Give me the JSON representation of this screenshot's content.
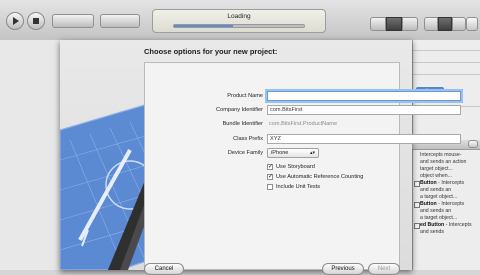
{
  "toolbar": {
    "status_text": "Loading",
    "progress": 0.45,
    "run_icon": "play-icon",
    "stop_icon": "stop-icon"
  },
  "inspector": {
    "button_label": "tion",
    "library_items": [
      {
        "title": "",
        "desc": "Intercepts mouse-"
      },
      {
        "title": "",
        "desc": "and sends an action"
      },
      {
        "title": "",
        "desc": "target object..."
      },
      {
        "title": "",
        "desc": "object when..."
      },
      {
        "title": "Button",
        "desc": " - Intercepts"
      },
      {
        "title": "",
        "desc": "and sends an"
      },
      {
        "title": "",
        "desc": "a target object..."
      },
      {
        "title": "Button",
        "desc": " - Intercepts"
      },
      {
        "title": "",
        "desc": "and sends an"
      },
      {
        "title": "",
        "desc": "a target object..."
      },
      {
        "title": "ed Button",
        "desc": " - Intercepts"
      },
      {
        "title": "",
        "desc": "and sends"
      }
    ]
  },
  "sheet": {
    "title": "Choose options for your new project:",
    "fields": {
      "product_name": {
        "label": "Product Name",
        "value": ""
      },
      "company_identifier": {
        "label": "Company Identifier",
        "value": "com.BitsFirst"
      },
      "bundle_identifier": {
        "label": "Bundle Identifier",
        "value": "com.BitsFirst.ProductName"
      },
      "class_prefix": {
        "label": "Class Prefix",
        "value": "XYZ"
      },
      "device_family": {
        "label": "Device Family",
        "value": "iPhone"
      }
    },
    "options": [
      {
        "label": "Use Storyboard",
        "checked": true,
        "mark": "✓"
      },
      {
        "label": "Use Automatic Reference Counting",
        "checked": true,
        "mark": "✓"
      },
      {
        "label": "Include Unit Tests",
        "checked": false,
        "mark": ""
      }
    ],
    "buttons": {
      "cancel": "Cancel",
      "previous": "Previous",
      "next": "Next"
    }
  },
  "colors": {
    "accent": "#5a85c2",
    "focus_ring": "#9cc0ee",
    "blueprint": "#4d7fd0"
  }
}
